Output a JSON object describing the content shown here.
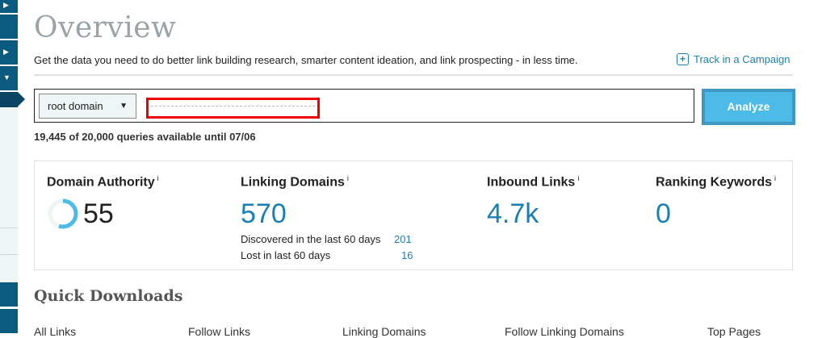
{
  "header": {
    "title": "Overview",
    "subtitle": "Get the data you need to do better link building research, smarter content ideation, and link prospecting - in less time.",
    "track_label": "Track in a Campaign"
  },
  "search": {
    "scope": "root domain",
    "analyze_label": "Analyze",
    "quota": "19,445 of 20,000 queries available until 07/06"
  },
  "metrics": {
    "da": {
      "label": "Domain Authority",
      "value": "55",
      "fraction": 0.55
    },
    "ld": {
      "label": "Linking Domains",
      "value": "570",
      "discovered_label": "Discovered in the last 60 days",
      "discovered": "201",
      "lost_label": "Lost in last 60 days",
      "lost": "16"
    },
    "il": {
      "label": "Inbound Links",
      "value": "4.7k"
    },
    "rk": {
      "label": "Ranking Keywords",
      "value": "0"
    },
    "info": "i"
  },
  "downloads": {
    "title": "Quick Downloads",
    "items": [
      "All Links",
      "Follow Links",
      "Linking Domains",
      "Follow Linking Domains",
      "Top Pages"
    ]
  }
}
